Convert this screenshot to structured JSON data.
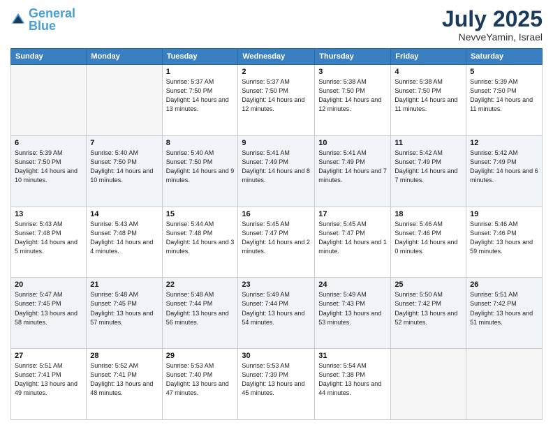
{
  "logo": {
    "line1": "General",
    "line2": "Blue"
  },
  "title": "July 2025",
  "subtitle": "NevveYamin, Israel",
  "days_header": [
    "Sunday",
    "Monday",
    "Tuesday",
    "Wednesday",
    "Thursday",
    "Friday",
    "Saturday"
  ],
  "weeks": [
    [
      {
        "day": "",
        "info": ""
      },
      {
        "day": "",
        "info": ""
      },
      {
        "day": "1",
        "info": "Sunrise: 5:37 AM\nSunset: 7:50 PM\nDaylight: 14 hours and 13 minutes."
      },
      {
        "day": "2",
        "info": "Sunrise: 5:37 AM\nSunset: 7:50 PM\nDaylight: 14 hours and 12 minutes."
      },
      {
        "day": "3",
        "info": "Sunrise: 5:38 AM\nSunset: 7:50 PM\nDaylight: 14 hours and 12 minutes."
      },
      {
        "day": "4",
        "info": "Sunrise: 5:38 AM\nSunset: 7:50 PM\nDaylight: 14 hours and 11 minutes."
      },
      {
        "day": "5",
        "info": "Sunrise: 5:39 AM\nSunset: 7:50 PM\nDaylight: 14 hours and 11 minutes."
      }
    ],
    [
      {
        "day": "6",
        "info": "Sunrise: 5:39 AM\nSunset: 7:50 PM\nDaylight: 14 hours and 10 minutes."
      },
      {
        "day": "7",
        "info": "Sunrise: 5:40 AM\nSunset: 7:50 PM\nDaylight: 14 hours and 10 minutes."
      },
      {
        "day": "8",
        "info": "Sunrise: 5:40 AM\nSunset: 7:50 PM\nDaylight: 14 hours and 9 minutes."
      },
      {
        "day": "9",
        "info": "Sunrise: 5:41 AM\nSunset: 7:49 PM\nDaylight: 14 hours and 8 minutes."
      },
      {
        "day": "10",
        "info": "Sunrise: 5:41 AM\nSunset: 7:49 PM\nDaylight: 14 hours and 7 minutes."
      },
      {
        "day": "11",
        "info": "Sunrise: 5:42 AM\nSunset: 7:49 PM\nDaylight: 14 hours and 7 minutes."
      },
      {
        "day": "12",
        "info": "Sunrise: 5:42 AM\nSunset: 7:49 PM\nDaylight: 14 hours and 6 minutes."
      }
    ],
    [
      {
        "day": "13",
        "info": "Sunrise: 5:43 AM\nSunset: 7:48 PM\nDaylight: 14 hours and 5 minutes."
      },
      {
        "day": "14",
        "info": "Sunrise: 5:43 AM\nSunset: 7:48 PM\nDaylight: 14 hours and 4 minutes."
      },
      {
        "day": "15",
        "info": "Sunrise: 5:44 AM\nSunset: 7:48 PM\nDaylight: 14 hours and 3 minutes."
      },
      {
        "day": "16",
        "info": "Sunrise: 5:45 AM\nSunset: 7:47 PM\nDaylight: 14 hours and 2 minutes."
      },
      {
        "day": "17",
        "info": "Sunrise: 5:45 AM\nSunset: 7:47 PM\nDaylight: 14 hours and 1 minute."
      },
      {
        "day": "18",
        "info": "Sunrise: 5:46 AM\nSunset: 7:46 PM\nDaylight: 14 hours and 0 minutes."
      },
      {
        "day": "19",
        "info": "Sunrise: 5:46 AM\nSunset: 7:46 PM\nDaylight: 13 hours and 59 minutes."
      }
    ],
    [
      {
        "day": "20",
        "info": "Sunrise: 5:47 AM\nSunset: 7:45 PM\nDaylight: 13 hours and 58 minutes."
      },
      {
        "day": "21",
        "info": "Sunrise: 5:48 AM\nSunset: 7:45 PM\nDaylight: 13 hours and 57 minutes."
      },
      {
        "day": "22",
        "info": "Sunrise: 5:48 AM\nSunset: 7:44 PM\nDaylight: 13 hours and 56 minutes."
      },
      {
        "day": "23",
        "info": "Sunrise: 5:49 AM\nSunset: 7:44 PM\nDaylight: 13 hours and 54 minutes."
      },
      {
        "day": "24",
        "info": "Sunrise: 5:49 AM\nSunset: 7:43 PM\nDaylight: 13 hours and 53 minutes."
      },
      {
        "day": "25",
        "info": "Sunrise: 5:50 AM\nSunset: 7:42 PM\nDaylight: 13 hours and 52 minutes."
      },
      {
        "day": "26",
        "info": "Sunrise: 5:51 AM\nSunset: 7:42 PM\nDaylight: 13 hours and 51 minutes."
      }
    ],
    [
      {
        "day": "27",
        "info": "Sunrise: 5:51 AM\nSunset: 7:41 PM\nDaylight: 13 hours and 49 minutes."
      },
      {
        "day": "28",
        "info": "Sunrise: 5:52 AM\nSunset: 7:41 PM\nDaylight: 13 hours and 48 minutes."
      },
      {
        "day": "29",
        "info": "Sunrise: 5:53 AM\nSunset: 7:40 PM\nDaylight: 13 hours and 47 minutes."
      },
      {
        "day": "30",
        "info": "Sunrise: 5:53 AM\nSunset: 7:39 PM\nDaylight: 13 hours and 45 minutes."
      },
      {
        "day": "31",
        "info": "Sunrise: 5:54 AM\nSunset: 7:38 PM\nDaylight: 13 hours and 44 minutes."
      },
      {
        "day": "",
        "info": ""
      },
      {
        "day": "",
        "info": ""
      }
    ]
  ]
}
